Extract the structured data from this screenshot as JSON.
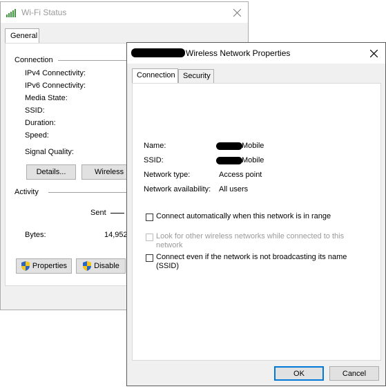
{
  "status_window": {
    "title": "Wi-Fi Status",
    "tab": "General",
    "connection_group": "Connection",
    "fields": [
      "IPv4 Connectivity:",
      "IPv6 Connectivity:",
      "Media State:",
      "SSID:",
      "Duration:",
      "Speed:"
    ],
    "signal_quality": "Signal Quality:",
    "details_button": "Details...",
    "wireless_button": "Wireless P",
    "activity_group": "Activity",
    "sent_label": "Sent",
    "bytes_label": "Bytes:",
    "bytes_sent": "14,952",
    "properties_button": "Properties",
    "disable_button": "Disable"
  },
  "props_window": {
    "title": "Wireless Network Properties",
    "tabs": [
      "Connection",
      "Security"
    ],
    "name_label": "Name:",
    "name_value": "Mobile",
    "ssid_label": "SSID:",
    "ssid_value": "Mobile",
    "type_label": "Network type:",
    "type_value": "Access point",
    "availability_label": "Network availability:",
    "availability_value": "All users",
    "options": [
      {
        "label": "Connect automatically when this network is in range",
        "checked": false,
        "enabled": true
      },
      {
        "label_line1": "Look for other wireless networks while connected to this",
        "label_line2": "network",
        "checked": false,
        "enabled": false
      },
      {
        "label_line1": "Connect even if the network is not broadcasting its name",
        "label_line2": "(SSID)",
        "checked": false,
        "enabled": true
      }
    ],
    "ok_button": "OK",
    "cancel_button": "Cancel"
  },
  "colors": {
    "accent": "#0078d7",
    "window_bg": "#f0f0f0",
    "redaction": "#000000"
  }
}
